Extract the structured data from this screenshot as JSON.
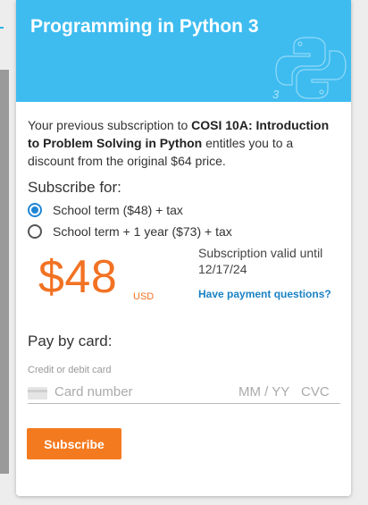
{
  "header": {
    "title": "Programming in Python 3",
    "logo_digit": "3"
  },
  "intro": {
    "prefix": "Your previous subscription to ",
    "course": "COSI 10A: Introduction to Problem Solving in Python",
    "suffix": " entitles you to a discount from the original $64 price."
  },
  "subscribe": {
    "heading": "Subscribe for:",
    "options": [
      {
        "label": "School term ($48) + tax",
        "selected": true
      },
      {
        "label": "School term + 1 year ($73) + tax",
        "selected": false
      }
    ]
  },
  "pricing": {
    "price": "$48",
    "currency": "USD",
    "valid_text": "Subscription valid until 12/17/24",
    "help_link": "Have payment questions?"
  },
  "payment": {
    "heading": "Pay by card:",
    "field_label": "Credit or debit card",
    "card_number_placeholder": "Card number",
    "expiry_placeholder": "MM / YY",
    "cvc_placeholder": "CVC",
    "submit_label": "Subscribe"
  },
  "colors": {
    "header_bg": "#3ebcf0",
    "accent_orange": "#f47a20",
    "link_blue": "#1a82c4",
    "radio_blue": "#1f86d6"
  }
}
